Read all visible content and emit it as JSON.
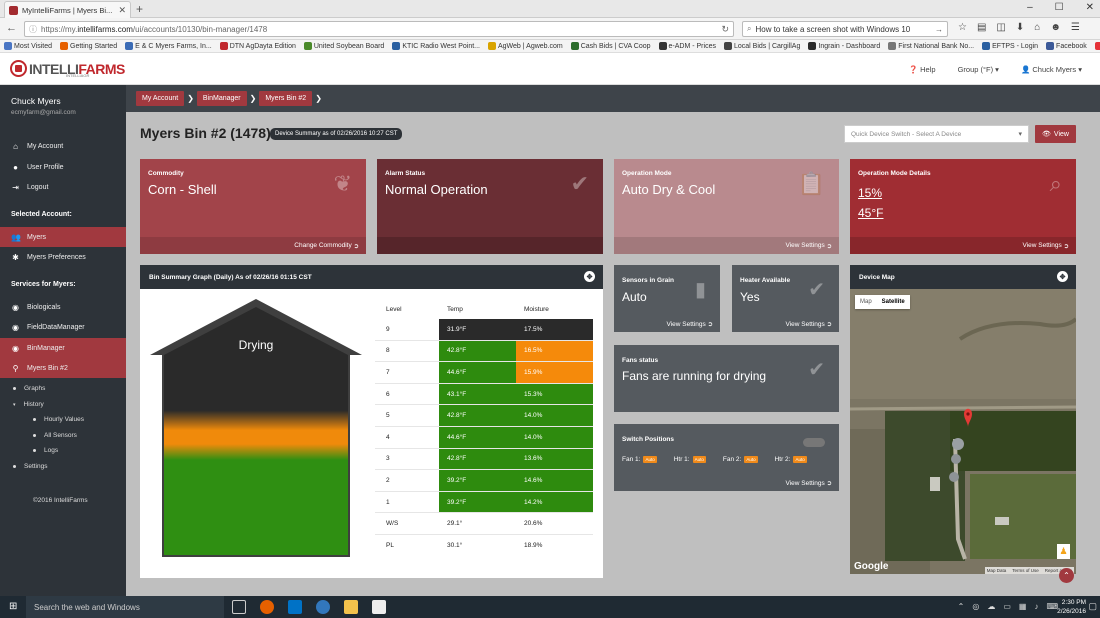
{
  "browser": {
    "tab_title": "MyIntelliFarms | Myers Bi...",
    "url_prefix": "https://my.",
    "url_domain": "intellifarms.com",
    "url_path": "/ui/accounts/10130/bin-manager/1478",
    "search_text": "How to take a screen shot with Windows 10",
    "bookmarks": [
      {
        "label": "Most Visited",
        "color": "#4a76c4"
      },
      {
        "label": "Getting Started",
        "color": "#e66000"
      },
      {
        "label": "E & C Myers Farms, In...",
        "color": "#3b6bb5"
      },
      {
        "label": "DTN AgDayta Edition",
        "color": "#c0282d"
      },
      {
        "label": "United Soybean Board",
        "color": "#4a8a2a"
      },
      {
        "label": "KTIC Radio West Point...",
        "color": "#2a5fa0"
      },
      {
        "label": "AgWeb | Agweb.com",
        "color": "#d9a400"
      },
      {
        "label": "Cash Bids | CVA Coop",
        "color": "#2c6d2c"
      },
      {
        "label": "e-ADM - Prices",
        "color": "#333333"
      },
      {
        "label": "Local Bids | CargillAg",
        "color": "#444444"
      },
      {
        "label": "Ingrain - Dashboard",
        "color": "#2a2a2a"
      },
      {
        "label": "First National Bank No...",
        "color": "#777777"
      },
      {
        "label": "EFTPS - Login",
        "color": "#2a5fa0"
      },
      {
        "label": "Facebook",
        "color": "#3b5998"
      },
      {
        "label": "eBay",
        "color": "#e53238"
      }
    ]
  },
  "app": {
    "logo_intelli": "INTELLI",
    "logo_farms": "FARMS",
    "logo_sub": "INTELLIAGR",
    "help": "Help",
    "group": "Group (°F)",
    "user_menu": "Chuck Myers"
  },
  "sidebar": {
    "user_name": "Chuck Myers",
    "user_email": "ecmyfarm@gmail.com",
    "nav": [
      "My Account",
      "User Profile",
      "Logout"
    ],
    "selected_account_heading": "Selected Account:",
    "account_items": [
      "Myers",
      "Myers Preferences"
    ],
    "services_heading": "Services for Myers:",
    "services": [
      "Biologicals",
      "FieldDataManager",
      "BinManager",
      "Myers Bin #2"
    ],
    "bin_sub": [
      "Graphs",
      "History",
      "Settings"
    ],
    "history_sub": [
      "Hourly Values",
      "All Sensors",
      "Logs"
    ],
    "copyright": "©2016 IntelliFarms"
  },
  "breadcrumbs": [
    "My Account",
    "BinManager",
    "Myers Bin #2"
  ],
  "page": {
    "title": "Myers Bin #2 (1478)",
    "device_summary": "Device Summary as of 02/26/2016 10:27 CST",
    "quick_switch_placeholder": "Quick Device Switch - Select A Device",
    "view_button": "View"
  },
  "cards": {
    "commodity": {
      "label": "Commodity",
      "value": "Corn - Shell",
      "action": "Change Commodity"
    },
    "alarm": {
      "label": "Alarm Status",
      "value": "Normal Operation"
    },
    "operation_mode": {
      "label": "Operation Mode",
      "value": "Auto Dry & Cool",
      "action": "View Settings"
    },
    "operation_details": {
      "label": "Operation Mode Details",
      "value1": "15%",
      "value2": "45°F",
      "action": "View Settings"
    }
  },
  "bin_graph": {
    "title": "Bin Summary Graph (Daily) As of 02/26/16 01:15 CST",
    "status": "Drying",
    "headers": [
      "Level",
      "Temp",
      "Moisture"
    ],
    "rows": [
      {
        "level": "9",
        "temp": "31.9°F",
        "moisture": "17.5%",
        "tc": "#2a2a2a",
        "mc": "#2a2a2a"
      },
      {
        "level": "8",
        "temp": "42.8°F",
        "moisture": "16.5%",
        "tc": "#2e8b0e",
        "mc": "#f58a0b"
      },
      {
        "level": "7",
        "temp": "44.6°F",
        "moisture": "15.9%",
        "tc": "#2e8b0e",
        "mc": "#f58a0b"
      },
      {
        "level": "6",
        "temp": "43.1°F",
        "moisture": "15.3%",
        "tc": "#2e8b0e",
        "mc": "#2e8b0e"
      },
      {
        "level": "5",
        "temp": "42.8°F",
        "moisture": "14.0%",
        "tc": "#2e8b0e",
        "mc": "#2e8b0e"
      },
      {
        "level": "4",
        "temp": "44.6°F",
        "moisture": "14.0%",
        "tc": "#2e8b0e",
        "mc": "#2e8b0e"
      },
      {
        "level": "3",
        "temp": "42.8°F",
        "moisture": "13.6%",
        "tc": "#2e8b0e",
        "mc": "#2e8b0e"
      },
      {
        "level": "2",
        "temp": "39.2°F",
        "moisture": "14.6%",
        "tc": "#2e8b0e",
        "mc": "#2e8b0e"
      },
      {
        "level": "1",
        "temp": "39.2°F",
        "moisture": "14.2%",
        "tc": "#2e8b0e",
        "mc": "#2e8b0e"
      },
      {
        "level": "W/S",
        "temp": "29.1°",
        "moisture": "20.6%",
        "tc": "",
        "mc": ""
      },
      {
        "level": "PL",
        "temp": "30.1°",
        "moisture": "18.9%",
        "tc": "",
        "mc": ""
      }
    ]
  },
  "widgets": {
    "sensors": {
      "label": "Sensors in Grain",
      "value": "Auto",
      "action": "View Settings"
    },
    "heater": {
      "label": "Heater Available",
      "value": "Yes",
      "action": "View Settings"
    },
    "fans": {
      "label": "Fans status",
      "value": "Fans are running for drying"
    },
    "switches": {
      "label": "Switch Positions",
      "fan1": "Fan 1:",
      "htr1": "Htr 1:",
      "fan2": "Fan 2:",
      "htr2": "Htr 2:",
      "auto": "Auto",
      "action": "View Settings"
    }
  },
  "device_map": {
    "title": "Device Map",
    "map_btn": "Map",
    "satellite_btn": "Satellite",
    "google": "Google",
    "attribution": [
      "Map Data",
      "Terms of Use",
      "Report a map"
    ]
  },
  "taskbar": {
    "search": "Search the web and Windows",
    "time": "2:30 PM",
    "date": "2/26/2016"
  },
  "colors": {
    "commodity": "#a2444a",
    "alarm": "#6a2e34",
    "operation_mode": "#b98a8e",
    "operation_details": "#a02d33"
  }
}
